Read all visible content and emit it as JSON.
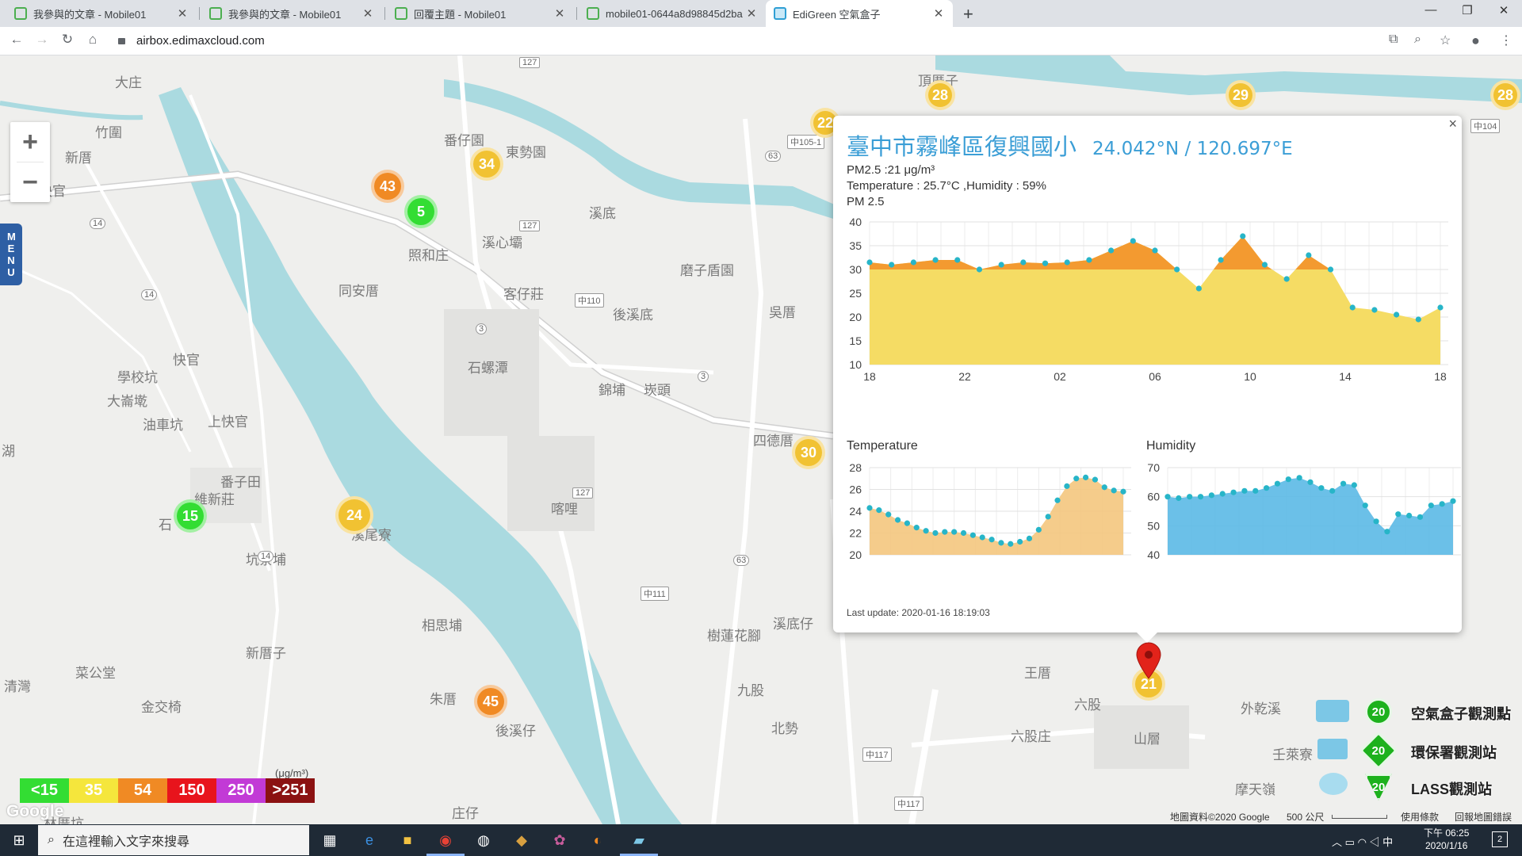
{
  "browser": {
    "tabs": [
      {
        "title": "我參與的文章 - Mobile01"
      },
      {
        "title": "我參與的文章 - Mobile01"
      },
      {
        "title": "回覆主題 - Mobile01"
      },
      {
        "title": "mobile01-0644a8d98845d2ba"
      },
      {
        "title": "EdiGreen 空氣盒子"
      }
    ],
    "new_tab": "+",
    "url": "airbox.edimaxcloud.com"
  },
  "map": {
    "zoom_in": "+",
    "zoom_out": "−",
    "menu_label": "MENU",
    "labels": [
      {
        "text": "大庄"
      },
      {
        "text": "竹圍"
      },
      {
        "text": "新厝"
      },
      {
        "text": "外快官"
      },
      {
        "text": "番仔園"
      },
      {
        "text": "東勢園"
      },
      {
        "text": "溪心壩"
      },
      {
        "text": "照和庄"
      },
      {
        "text": "同安厝"
      },
      {
        "text": "溪底"
      },
      {
        "text": "客仔莊"
      },
      {
        "text": "後溪底"
      },
      {
        "text": "磨子盾園"
      },
      {
        "text": "吳厝"
      },
      {
        "text": "頂厝子"
      },
      {
        "text": "學校坑"
      },
      {
        "text": "大崙墘"
      },
      {
        "text": "快官"
      },
      {
        "text": "油車坑"
      },
      {
        "text": "上快官"
      },
      {
        "text": "石螺潭"
      },
      {
        "text": "錦埔"
      },
      {
        "text": "崁頭"
      },
      {
        "text": "番子田"
      },
      {
        "text": "維新莊"
      },
      {
        "text": "喀哩"
      },
      {
        "text": "溪尾寮"
      },
      {
        "text": "坑寮埔"
      },
      {
        "text": "相思埔"
      },
      {
        "text": "新厝子"
      },
      {
        "text": "菜公堂"
      },
      {
        "text": "金交椅"
      },
      {
        "text": "朱厝"
      },
      {
        "text": "後溪仔"
      },
      {
        "text": "樹蓮花腳"
      },
      {
        "text": "溪底仔"
      },
      {
        "text": "九股"
      },
      {
        "text": "北勢"
      },
      {
        "text": "王厝"
      },
      {
        "text": "六股庄"
      },
      {
        "text": "外乾溪"
      },
      {
        "text": "壬萊寮"
      },
      {
        "text": "摩天嶺"
      },
      {
        "text": "四德厝"
      },
      {
        "text": "庄仔"
      },
      {
        "text": "湖"
      },
      {
        "text": "石"
      },
      {
        "text": "林厝坑"
      },
      {
        "text": "清灣"
      },
      {
        "text": "山層"
      },
      {
        "text": "六股"
      }
    ],
    "roads": [
      {
        "text": "127"
      },
      {
        "text": "127"
      },
      {
        "text": "中105-1"
      },
      {
        "text": "中110"
      },
      {
        "text": "3"
      },
      {
        "text": "3"
      },
      {
        "text": "63"
      },
      {
        "text": "63"
      },
      {
        "text": "127"
      },
      {
        "text": "中111"
      },
      {
        "text": "14"
      },
      {
        "text": "14"
      },
      {
        "text": "14"
      },
      {
        "text": "中117"
      },
      {
        "text": "中117"
      },
      {
        "text": "中104"
      }
    ],
    "clusters": [
      {
        "value": "28",
        "color": "yellow"
      },
      {
        "value": "29",
        "color": "yellow"
      },
      {
        "value": "28",
        "color": "yellow"
      },
      {
        "value": "22",
        "color": "yellow"
      },
      {
        "value": "43",
        "color": "orange"
      },
      {
        "value": "5",
        "color": "green"
      },
      {
        "value": "34",
        "color": "yellow"
      },
      {
        "value": "30",
        "color": "yellow"
      },
      {
        "value": "24",
        "color": "yellow"
      },
      {
        "value": "15",
        "color": "green"
      },
      {
        "value": "45",
        "color": "orange"
      },
      {
        "value": "21",
        "color": "yellow"
      }
    ],
    "legend": {
      "unit": "(μg/m³)",
      "levels": [
        {
          "label": "<15",
          "color": "#33dd33"
        },
        {
          "label": "35",
          "color": "#f5e63c"
        },
        {
          "label": "54",
          "color": "#f08a24"
        },
        {
          "label": "150",
          "color": "#e8141c"
        },
        {
          "label": "250",
          "color": "#c23ad6"
        },
        {
          "label": ">251",
          "color": "#8b1212"
        }
      ]
    },
    "google_logo": "Google",
    "footer": {
      "copyright": "地圖資料©2020 Google",
      "scale": "500 公尺",
      "terms": "使用條款",
      "report": "回報地圖錯誤"
    },
    "station_legend": [
      {
        "value": "20",
        "label": "空氣盒子觀測點"
      },
      {
        "value": "20",
        "label": "環保署觀測站"
      },
      {
        "value": "20",
        "label": "LASS觀測站"
      }
    ]
  },
  "popup": {
    "close": "×",
    "title": "臺中市霧峰區復興國小",
    "coords": "24.042°N / 120.697°E",
    "pm25_line": "PM2.5 :21 μg/m³",
    "temp_line": "Temperature : 25.7°C ,Humidity : 59%",
    "chart_title": "PM 2.5",
    "temp_title": "Temperature",
    "hum_title": "Humidity",
    "last_update": "Last update: 2020-01-16 18:19:03"
  },
  "chart_data": [
    {
      "type": "area",
      "title": "PM 2.5",
      "xlabel": "",
      "ylabel": "",
      "ylim": [
        10,
        40
      ],
      "yticks": [
        "10",
        "15",
        "20",
        "25",
        "30",
        "35",
        "40"
      ],
      "xticks": [
        "18",
        "22",
        "02",
        "06",
        "10",
        "14",
        "18"
      ],
      "x_hours": [
        0,
        1,
        2,
        3,
        4,
        5,
        6,
        7,
        8,
        9,
        10,
        11,
        12,
        13,
        14,
        15,
        16,
        17,
        18,
        19,
        20,
        21,
        22,
        23,
        24
      ],
      "values": [
        31.5,
        31,
        31.5,
        32,
        32,
        30,
        31,
        31.5,
        31.3,
        31.5,
        32,
        34,
        36,
        34,
        30,
        26,
        32,
        37,
        31,
        28,
        33,
        30,
        22,
        21.5,
        20.5,
        19.5,
        22
      ],
      "threshold": 30,
      "colors": {
        "below": "#f5dc64",
        "above": "#f39a30",
        "points": "#27b5c8"
      }
    },
    {
      "type": "area",
      "title": "Temperature",
      "ylim": [
        20,
        28
      ],
      "yticks": [
        "20",
        "22",
        "24",
        "26",
        "28"
      ],
      "values": [
        24.3,
        24.1,
        23.7,
        23.2,
        22.9,
        22.5,
        22.2,
        22,
        22.1,
        22.1,
        22,
        21.8,
        21.6,
        21.4,
        21.1,
        21,
        21.2,
        21.5,
        22.3,
        23.5,
        25,
        26.3,
        27,
        27.1,
        26.9,
        26.2,
        25.9,
        25.8
      ],
      "colors": {
        "fill": "#f4c77e",
        "points": "#27b5c8"
      }
    },
    {
      "type": "area",
      "title": "Humidity",
      "ylim": [
        40,
        70
      ],
      "yticks": [
        "40",
        "50",
        "60",
        "70"
      ],
      "values": [
        60,
        59.5,
        60,
        60,
        60.5,
        61,
        61.5,
        62,
        62,
        63,
        64.5,
        66,
        66.5,
        65,
        63,
        62,
        64.5,
        64,
        57,
        51.5,
        48,
        54,
        53.5,
        53,
        57,
        57.5,
        58.5
      ],
      "colors": {
        "fill": "#5bb9e6",
        "points": "#27b5c8"
      }
    }
  ],
  "taskbar": {
    "search_placeholder": "在這裡輸入文字來搜尋",
    "time": "下午 06:25",
    "date": "2020/1/16",
    "ime": "中",
    "notif_count": "2"
  }
}
